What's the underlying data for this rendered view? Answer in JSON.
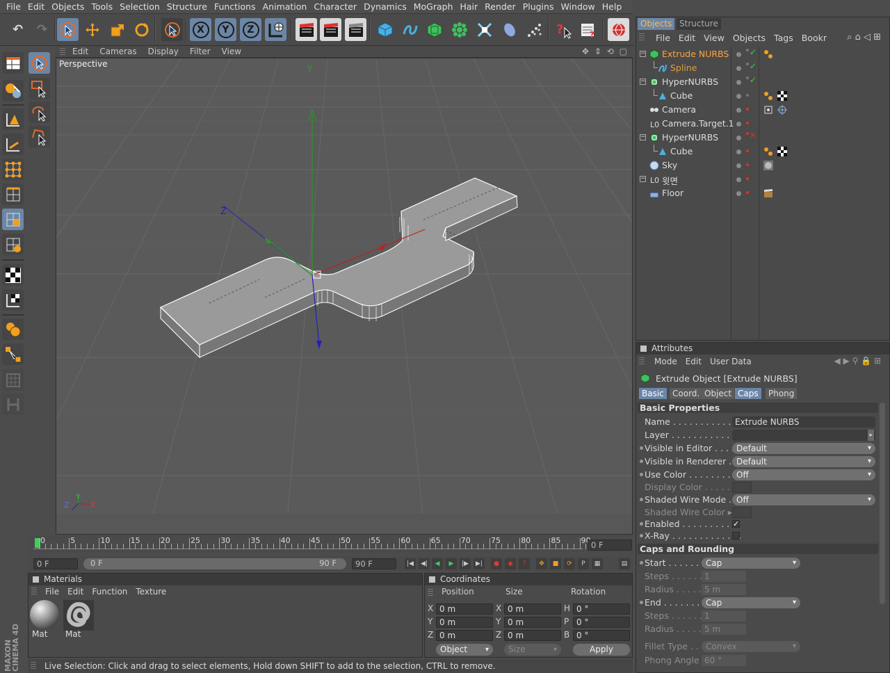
{
  "menu": [
    "File",
    "Edit",
    "Objects",
    "Tools",
    "Selection",
    "Structure",
    "Functions",
    "Animation",
    "Character",
    "Dynamics",
    "MoGraph",
    "Hair",
    "Render",
    "Plugins",
    "Window",
    "Help"
  ],
  "toolbar_icons": {
    "undo": "↶",
    "redo": "↷",
    "x": "X",
    "y": "Y",
    "z": "Z"
  },
  "viewport": {
    "menu": [
      "Edit",
      "Cameras",
      "Display",
      "Filter",
      "View"
    ],
    "label": "Perspective",
    "axis_y": "Y",
    "axis_z": "Z",
    "axis_x": "X"
  },
  "timeline": {
    "ticks": [
      "0",
      "5",
      "10",
      "15",
      "20",
      "25",
      "30",
      "35",
      "40",
      "45",
      "50",
      "55",
      "60",
      "65",
      "70",
      "75",
      "80",
      "85",
      "90"
    ],
    "current_frame": "0 F",
    "start_field": "0 F",
    "range_start": "0 F",
    "range_end": "90 F",
    "end_field": "90 F"
  },
  "materials": {
    "title": "Materials",
    "menu": [
      "File",
      "Edit",
      "Function",
      "Texture"
    ],
    "items": [
      "Mat",
      "Mat"
    ]
  },
  "coordinates": {
    "title": "Coordinates",
    "headers": [
      "Position",
      "Size",
      "Rotation"
    ],
    "rows": [
      {
        "pl": "X",
        "pv": "0 m",
        "sl": "X",
        "sv": "0 m",
        "rl": "H",
        "rv": "0 °"
      },
      {
        "pl": "Y",
        "pv": "0 m",
        "sl": "Y",
        "sv": "0 m",
        "rl": "P",
        "rv": "0 °"
      },
      {
        "pl": "Z",
        "pv": "0 m",
        "sl": "Z",
        "sv": "0 m",
        "rl": "B",
        "rv": "0 °"
      }
    ],
    "mode": "Object",
    "size_mode": "Size",
    "apply": "Apply"
  },
  "status": "Live Selection: Click and drag to select elements, Hold down SHIFT to add to the selection, CTRL to remove.",
  "brand": {
    "line1": "MAXON",
    "line2": "CINEMA 4D"
  },
  "objects_panel": {
    "tabs": [
      "Objects",
      "Structure"
    ],
    "menu": [
      "File",
      "Edit",
      "View",
      "Objects",
      "Tags",
      "Bookr"
    ],
    "items": [
      {
        "name": "Extrude NURBS",
        "indent": 0,
        "color": "#ffa43a",
        "icon": "extrude-nurbs-icon"
      },
      {
        "name": "Spline",
        "indent": 1,
        "color": "#e0a040",
        "icon": "spline-icon"
      },
      {
        "name": "HyperNURBS",
        "indent": 0,
        "color": "#dedede",
        "icon": "hypernurbs-icon"
      },
      {
        "name": "Cube",
        "indent": 1,
        "color": "#dedede",
        "icon": "cube-icon"
      },
      {
        "name": "Camera",
        "indent": 0,
        "color": "#dedede",
        "icon": "camera-icon"
      },
      {
        "name": "Camera.Target.1",
        "indent": 0,
        "color": "#dedede",
        "icon": "null-icon"
      },
      {
        "name": "HyperNURBS",
        "indent": 0,
        "color": "#dedede",
        "icon": "hypernurbs-icon"
      },
      {
        "name": "Cube",
        "indent": 1,
        "color": "#dedede",
        "icon": "cube-icon"
      },
      {
        "name": "Sky",
        "indent": 0,
        "color": "#dedede",
        "icon": "sky-icon"
      },
      {
        "name": "윗면",
        "indent": 0,
        "color": "#dedede",
        "icon": "null-icon"
      },
      {
        "name": "Floor",
        "indent": 0,
        "color": "#dedede",
        "icon": "floor-icon"
      }
    ]
  },
  "attributes": {
    "title": "Attributes",
    "menu": [
      "Mode",
      "Edit",
      "User Data"
    ],
    "object_title": "Extrude Object [Extrude NURBS]",
    "tabs": [
      "Basic",
      "Coord.",
      "Object",
      "Caps",
      "Phong"
    ],
    "section_basic": "Basic Properties",
    "name_label": "Name",
    "name_value": "Extrude NURBS",
    "layer_label": "Layer",
    "vis_editor_label": "Visible in Editor",
    "vis_editor_value": "Default",
    "vis_render_label": "Visible in Renderer",
    "vis_render_value": "Default",
    "use_color_label": "Use Color",
    "use_color_value": "Off",
    "display_color_label": "Display Color",
    "shaded_wire_label": "Shaded Wire Mode",
    "shaded_wire_value": "Off",
    "shaded_wire_color_label": "Shaded Wire Color",
    "enabled_label": "Enabled",
    "xray_label": "X-Ray",
    "section_caps": "Caps and Rounding",
    "start_label": "Start",
    "start_value": "Cap",
    "steps_label": "Steps",
    "steps_value": "1",
    "radius_label": "Radius",
    "radius_value": "5 m",
    "end_label": "End",
    "end_value": "Cap",
    "steps2_value": "1",
    "radius2_value": "5 m",
    "fillet_label": "Fillet Type",
    "fillet_value": "Convex",
    "phong_label": "Phong Angle",
    "phong_value": "60 °"
  }
}
